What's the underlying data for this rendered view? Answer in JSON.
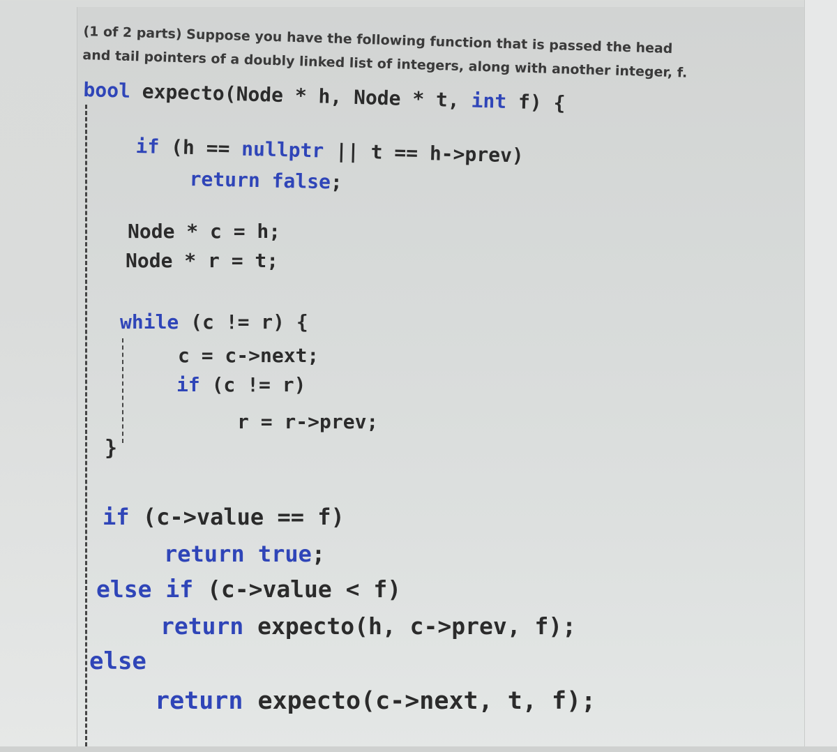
{
  "question": {
    "prompt_line1": "(1 of 2 parts) Suppose you have the following function that is passed the head",
    "prompt_line2": "and  tail pointers of a doubly linked list of integers, along with another integer, f."
  },
  "code": {
    "signature": {
      "type": "bool",
      "rest": " expecto(Node * h, Node * t, ",
      "int": "int",
      "end": " f) {"
    },
    "guard_if": {
      "kw": "if",
      "a": " (h == ",
      "null": "nullptr",
      "b": " || t == h->prev)"
    },
    "guard_return": {
      "kw": "return",
      "sp": " ",
      "val": "false",
      "end": ";"
    },
    "decl_c": "Node * c = h;",
    "decl_r": "Node * r = t;",
    "while_line": {
      "kw": "while",
      "rest": " (c != r) {"
    },
    "advance_c": "c = c->next;",
    "inner_if": {
      "kw": "if",
      "rest": " (c != r)"
    },
    "retreat_r": "r = r->prev;",
    "close_brace": "}",
    "check_if": {
      "kw": "if",
      "rest": " (c->value == f)"
    },
    "return_true": {
      "kw": "return",
      "sp": " ",
      "val": "true",
      "end": ";"
    },
    "else_if": {
      "kw1": "else",
      "sp": " ",
      "kw2": "if",
      "rest": " (c->value < f)"
    },
    "return_left": {
      "kw": "return",
      "rest": " expecto(h, c->prev, f);"
    },
    "else_kw": "else",
    "return_right": {
      "kw": "return",
      "rest": " expecto(c->next, t, f);"
    }
  }
}
